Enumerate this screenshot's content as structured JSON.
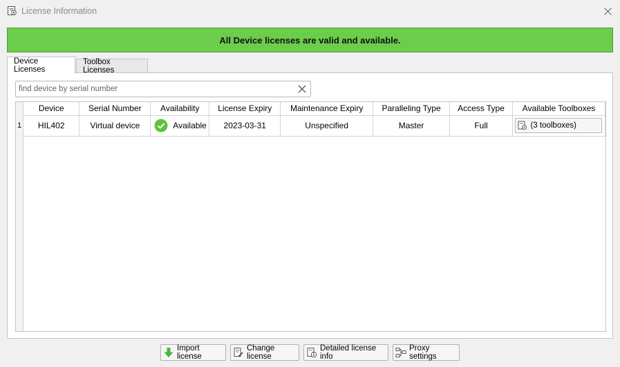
{
  "window": {
    "title": "License Information",
    "title_icon": "license-icon",
    "close_icon": "close-icon"
  },
  "banner": {
    "text": "All Device licenses are valid and available.",
    "color": "#6ccd4c"
  },
  "tabs": [
    {
      "label": "Device Licenses",
      "active": true
    },
    {
      "label": "Toolbox Licenses",
      "active": false
    }
  ],
  "search": {
    "placeholder": "find device by serial number",
    "value": "",
    "clear_icon": "clear-icon"
  },
  "table": {
    "columns": [
      "Device",
      "Serial Number",
      "Availability",
      "License Expiry",
      "Maintenance Expiry",
      "Paralleling Type",
      "Access Type",
      "Available Toolboxes"
    ],
    "rows": [
      {
        "index": "1",
        "device": "HIL402",
        "serial": "Virtual device",
        "availability": "Available",
        "availability_icon": "check-icon",
        "license_expiry": "2023-03-31",
        "maintenance_expiry": "Unspecified",
        "paralleling": "Master",
        "access": "Full",
        "toolboxes": "(3 toolboxes)"
      }
    ]
  },
  "footer": {
    "import_label": "Import license",
    "change_label": "Change license",
    "detailed_label": "Detailed license info",
    "proxy_label": "Proxy settings"
  }
}
